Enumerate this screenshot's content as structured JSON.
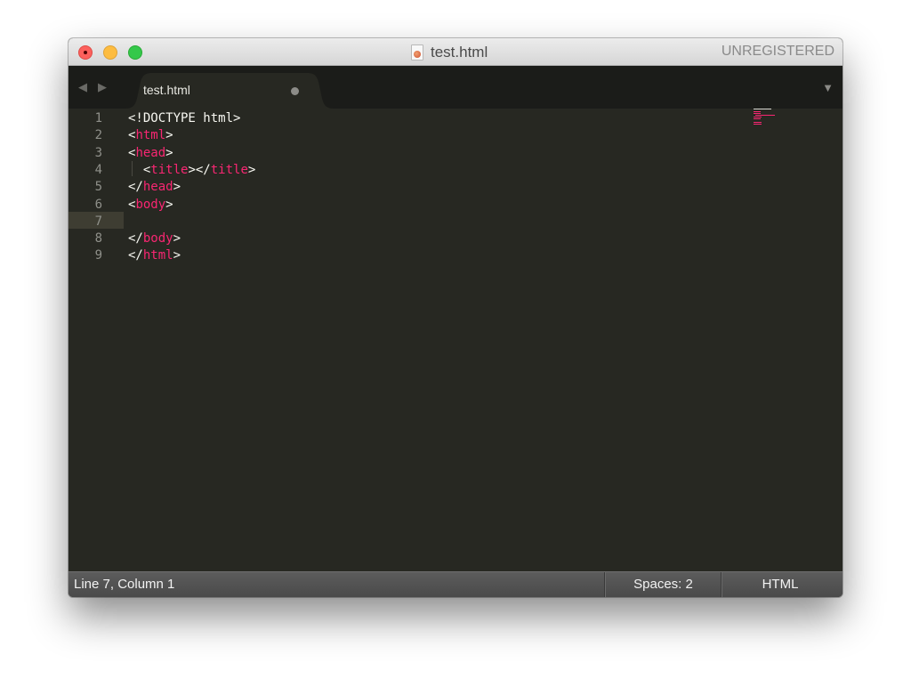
{
  "window": {
    "title": "test.html",
    "registration": "UNREGISTERED"
  },
  "tabs": {
    "nav_back_icon": "◀",
    "nav_forward_icon": "▶",
    "active_tab_label": "test.html",
    "tab_modified_indicator": "dirty-dot",
    "tab_menu_icon": "▼"
  },
  "editor": {
    "line_numbers": [
      "1",
      "2",
      "3",
      "4",
      "5",
      "6",
      "7",
      "8",
      "9"
    ],
    "current_line": 7,
    "lines": [
      [
        {
          "t": "<!DOCTYPE html>",
          "c": "text"
        }
      ],
      [
        {
          "t": "<",
          "c": "text"
        },
        {
          "t": "html",
          "c": "tag"
        },
        {
          "t": ">",
          "c": "text"
        }
      ],
      [
        {
          "t": "<",
          "c": "text"
        },
        {
          "t": "head",
          "c": "tag"
        },
        {
          "t": ">",
          "c": "text"
        }
      ],
      [
        {
          "t": "  <",
          "c": "text"
        },
        {
          "t": "title",
          "c": "tag"
        },
        {
          "t": "></",
          "c": "text"
        },
        {
          "t": "title",
          "c": "tag"
        },
        {
          "t": ">",
          "c": "text"
        }
      ],
      [
        {
          "t": "</",
          "c": "text"
        },
        {
          "t": "head",
          "c": "tag"
        },
        {
          "t": ">",
          "c": "text"
        }
      ],
      [
        {
          "t": "<",
          "c": "text"
        },
        {
          "t": "body",
          "c": "tag"
        },
        {
          "t": ">",
          "c": "text"
        }
      ],
      [],
      [
        {
          "t": "</",
          "c": "text"
        },
        {
          "t": "body",
          "c": "tag"
        },
        {
          "t": ">",
          "c": "text"
        }
      ],
      [
        {
          "t": "</",
          "c": "text"
        },
        {
          "t": "html",
          "c": "tag"
        },
        {
          "t": ">",
          "c": "text"
        }
      ]
    ]
  },
  "status": {
    "position": "Line 7, Column 1",
    "indentation": "Spaces: 2",
    "syntax": "HTML"
  },
  "colors": {
    "editor_bg": "#272822",
    "tag": "#f92672",
    "text": "#f8f8f2",
    "line_number": "#8f908a",
    "current_line": "#3e3d32"
  }
}
